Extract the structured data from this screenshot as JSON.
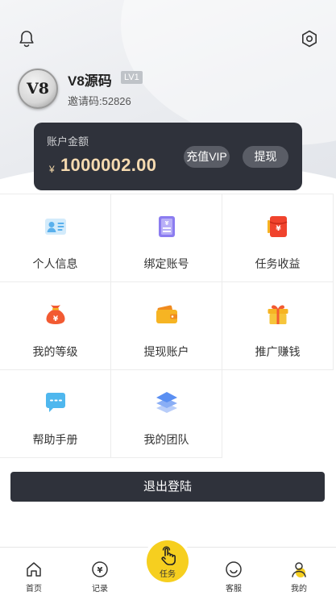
{
  "header": {
    "bell_icon": "bell-icon",
    "settings_icon": "gear-icon",
    "avatar_text": "V8",
    "username": "V8源码",
    "level": "LV1",
    "invite": "邀请码:52826"
  },
  "balance": {
    "label": "账户金额",
    "currency": "¥",
    "amount": "1000002.00",
    "recharge_vip": "充值VIP",
    "withdraw": "提现"
  },
  "menu": {
    "items": [
      {
        "label": "个人信息",
        "icon": "id-card-icon",
        "color": "#5ab0ec"
      },
      {
        "label": "绑定账号",
        "icon": "bind-account-icon",
        "color": "#8b7cf0"
      },
      {
        "label": "任务收益",
        "icon": "red-envelope-icon",
        "color": "#f0432d"
      },
      {
        "label": "我的等级",
        "icon": "money-bag-icon",
        "color": "#f25a32"
      },
      {
        "label": "提现账户",
        "icon": "wallet-icon",
        "color": "#f6b423"
      },
      {
        "label": "推广赚钱",
        "icon": "gift-icon",
        "color": "#f6b423"
      },
      {
        "label": "帮助手册",
        "icon": "chat-bubble-icon",
        "color": "#4fb7ee"
      },
      {
        "label": "我的团队",
        "icon": "layers-icon",
        "color": "#5a8ff2"
      }
    ]
  },
  "logout": "退出登陆",
  "tabbar": {
    "home": "首页",
    "record": "记录",
    "task": "任务",
    "service": "客服",
    "mine": "我的"
  },
  "colors": {
    "card_bg": "#2f323b",
    "amount_gold": "#f5dab0",
    "task_yellow": "#f6cf1f"
  }
}
